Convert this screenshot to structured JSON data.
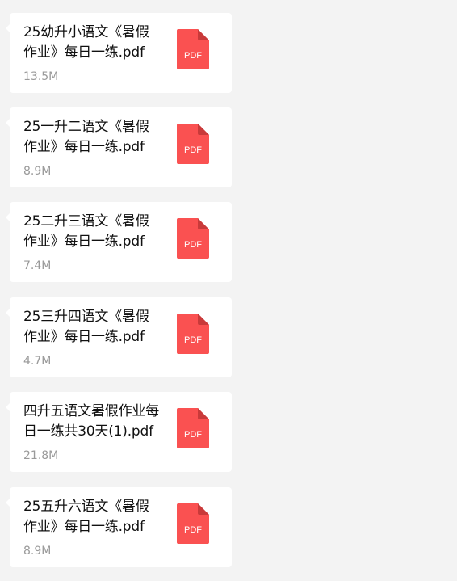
{
  "files": [
    {
      "name": "25幼升小语文《暑假作业》每日一练.pdf",
      "size": "13.5M",
      "icon": "pdf-icon",
      "icon_label": "PDF"
    },
    {
      "name": "25一升二语文《暑假作业》每日一练.pdf",
      "size": "8.9M",
      "icon": "pdf-icon",
      "icon_label": "PDF"
    },
    {
      "name": "25二升三语文《暑假作业》每日一练.pdf",
      "size": "7.4M",
      "icon": "pdf-icon",
      "icon_label": "PDF"
    },
    {
      "name": "25三升四语文《暑假作业》每日一练.pdf",
      "size": "4.7M",
      "icon": "pdf-icon",
      "icon_label": "PDF"
    },
    {
      "name": "四升五语文暑假作业每日一练共30天(1).pdf",
      "size": "21.8M",
      "icon": "pdf-icon",
      "icon_label": "PDF"
    },
    {
      "name": "25五升六语文《暑假作业》每日一练.pdf",
      "size": "8.9M",
      "icon": "pdf-icon",
      "icon_label": "PDF"
    }
  ],
  "colors": {
    "background": "#f3f3f3",
    "bubble": "#ffffff",
    "pdf_red": "#fa5151",
    "pdf_fold": "#c93a3a",
    "size_text": "#9a9a9a"
  }
}
